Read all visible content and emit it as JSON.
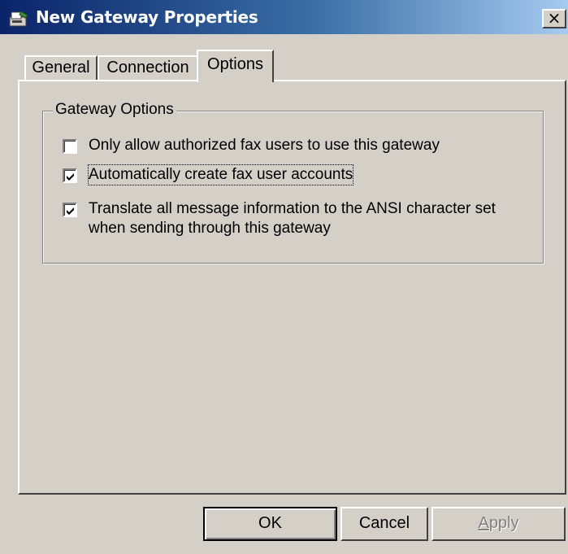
{
  "window": {
    "title": "New Gateway Properties",
    "close_glyph": "×",
    "title_gradient_start": "#0a246a",
    "title_gradient_end": "#a6caf0",
    "face_color": "#d4d0c8"
  },
  "tabs": [
    {
      "label": "General",
      "selected": false
    },
    {
      "label": "Connection",
      "selected": false
    },
    {
      "label": "Options",
      "selected": true
    }
  ],
  "group": {
    "title": "Gateway Options",
    "options": [
      {
        "label": "Only allow authorized fax users to use this gateway",
        "checked": false
      },
      {
        "label": "Automatically create fax user accounts",
        "checked": true,
        "focused": true
      },
      {
        "label_line1": "Translate all message information to the ANSI character set",
        "label_line2": "when sending through this gateway",
        "checked": true
      }
    ]
  },
  "buttons": {
    "ok": "OK",
    "cancel": "Cancel",
    "apply_underlined_letter": "A",
    "apply_rest": "pply"
  },
  "icons": {
    "app": "fax-gateway-icon",
    "close": "close-icon",
    "check": "checkmark-icon"
  }
}
